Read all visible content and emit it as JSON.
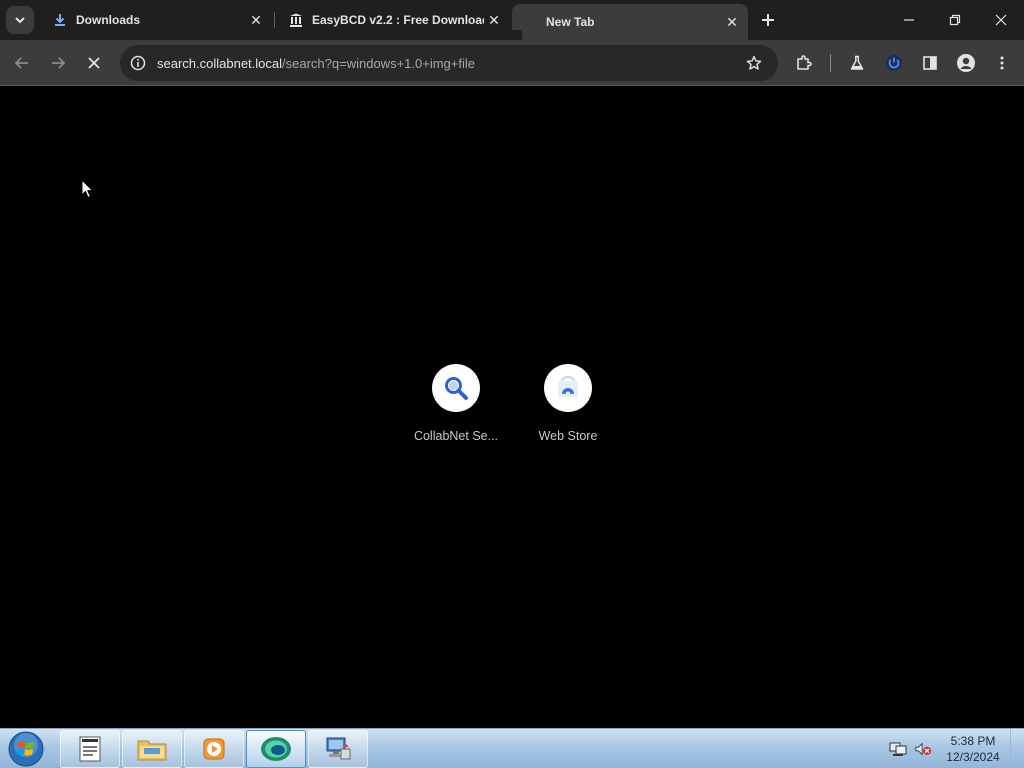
{
  "tabs": [
    {
      "title": "Downloads",
      "icon": "download-icon"
    },
    {
      "title": "EasyBCD v2.2 : Free Download",
      "icon": "columns-icon"
    },
    {
      "title": "New Tab",
      "icon": "none"
    }
  ],
  "toolbar": {
    "url_host": "search.collabnet.local",
    "url_path": "/search?q=windows+1.0+img+file"
  },
  "shortcuts": [
    {
      "label": "CollabNet Se...",
      "icon": "search-icon"
    },
    {
      "label": "Web Store",
      "icon": "web-store-icon"
    }
  ],
  "taskbar": {
    "time": "5:38 PM",
    "date": "12/3/2024"
  },
  "colors": {
    "tabstrip": "#1f1f1f",
    "toolbar": "#3c3c3c",
    "omnibox": "#282828",
    "page_background": "#000000",
    "accent_blue": "#3b6fe0"
  }
}
